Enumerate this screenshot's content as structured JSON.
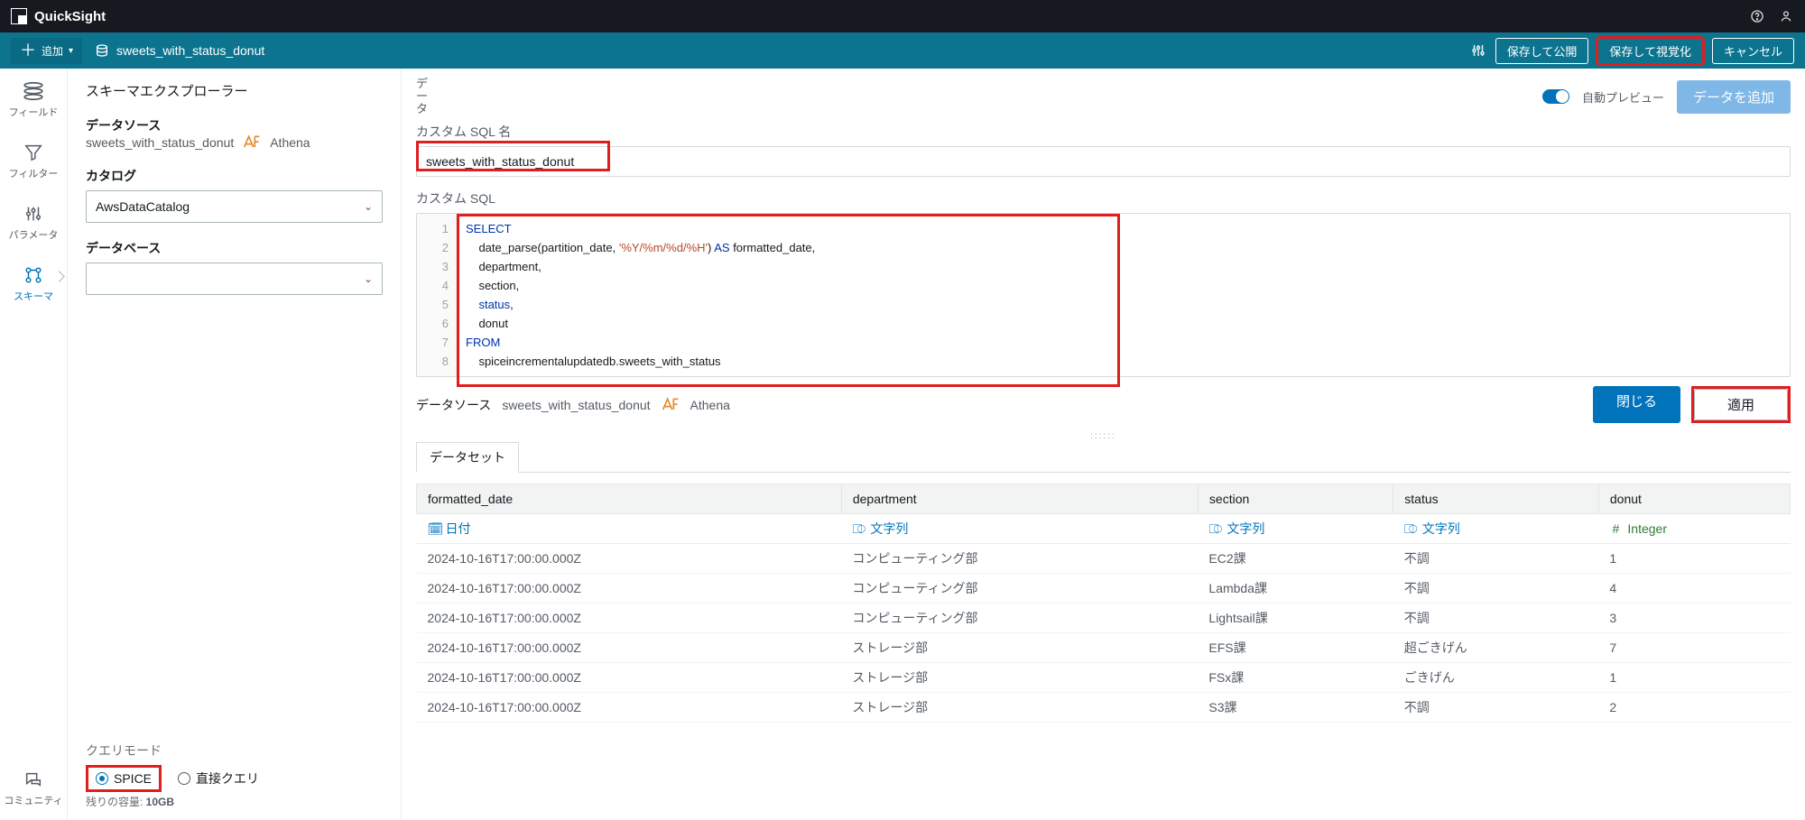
{
  "brand": "QuickSight",
  "toolbar": {
    "add_label": "追加",
    "dataset_name": "sweets_with_status_donut",
    "save_publish": "保存して公開",
    "save_visualize": "保存して視覚化",
    "cancel": "キャンセル"
  },
  "rail": {
    "fields": "フィールド",
    "filters": "フィルター",
    "parameters": "パラメータ",
    "schema": "スキーマ",
    "community": "コミュニティ"
  },
  "schema_panel": {
    "title": "スキーマエクスプローラー",
    "datasource_label": "データソース",
    "datasource_name": "sweets_with_status_donut",
    "engine": "Athena",
    "catalog_label": "カタログ",
    "catalog_value": "AwsDataCatalog",
    "database_label": "データベース",
    "database_value": "",
    "query_mode_label": "クエリモード",
    "spice_label": "SPICE",
    "direct_label": "直接クエリ",
    "remaining_prefix": "残りの容量: ",
    "remaining_value": "10GB"
  },
  "content": {
    "data_label": "データ",
    "auto_preview": "自動プレビュー",
    "add_data_btn": "データを追加",
    "sql_name_label": "カスタム SQL 名",
    "sql_name_value": "sweets_with_status_donut",
    "custom_sql_label": "カスタム SQL",
    "ds_label": "データソース",
    "ds_name": "sweets_with_status_donut",
    "ds_engine": "Athena",
    "close_btn": "閉じる",
    "apply_btn": "適用",
    "tab_dataset": "データセット",
    "sql_lines": [
      {
        "n": 1,
        "raw": "SELECT"
      },
      {
        "n": 2,
        "raw": "    date_parse(partition_date, '%Y/%m/%d/%H') AS formatted_date,"
      },
      {
        "n": 3,
        "raw": "    department,"
      },
      {
        "n": 4,
        "raw": "    section,"
      },
      {
        "n": 5,
        "raw": "    status,"
      },
      {
        "n": 6,
        "raw": "    donut"
      },
      {
        "n": 7,
        "raw": "FROM"
      },
      {
        "n": 8,
        "raw": "    spiceincrementalupdatedb.sweets_with_status"
      }
    ]
  },
  "table": {
    "columns": [
      "formatted_date",
      "department",
      "section",
      "status",
      "donut"
    ],
    "types": [
      "日付",
      "文字列",
      "文字列",
      "文字列",
      "Integer"
    ],
    "type_icons": [
      "calendar",
      "char",
      "char",
      "char",
      "hash"
    ],
    "rows": [
      [
        "2024-10-16T17:00:00.000Z",
        "コンピューティング部",
        "EC2課",
        "不調",
        "1"
      ],
      [
        "2024-10-16T17:00:00.000Z",
        "コンピューティング部",
        "Lambda課",
        "不調",
        "4"
      ],
      [
        "2024-10-16T17:00:00.000Z",
        "コンピューティング部",
        "Lightsail課",
        "不調",
        "3"
      ],
      [
        "2024-10-16T17:00:00.000Z",
        "ストレージ部",
        "EFS課",
        "超ごきげん",
        "7"
      ],
      [
        "2024-10-16T17:00:00.000Z",
        "ストレージ部",
        "FSx課",
        "ごきげん",
        "1"
      ],
      [
        "2024-10-16T17:00:00.000Z",
        "ストレージ部",
        "S3課",
        "不調",
        "2"
      ]
    ]
  }
}
